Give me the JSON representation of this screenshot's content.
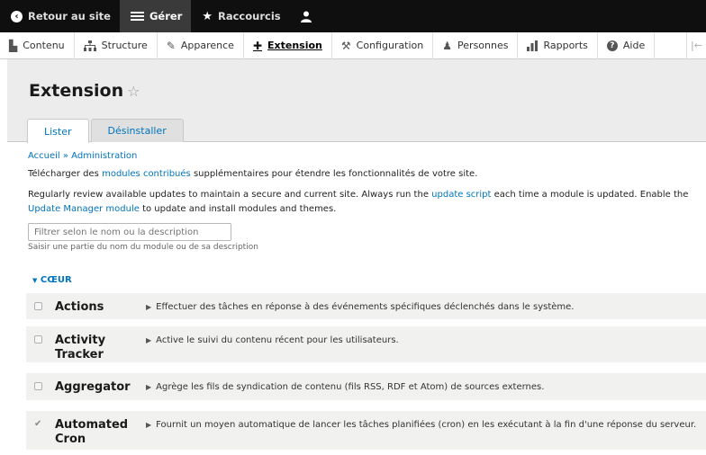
{
  "toolbar": {
    "back": "Retour au site",
    "manage": "Gérer",
    "shortcuts": "Raccourcis",
    "user_icon": "person-icon"
  },
  "tray": {
    "items": [
      {
        "label": "Contenu",
        "icon": "file-icon"
      },
      {
        "label": "Structure",
        "icon": "sitemap-icon"
      },
      {
        "label": "Apparence",
        "icon": "paint-icon"
      },
      {
        "label": "Extension",
        "icon": "puzzle-icon"
      },
      {
        "label": "Configuration",
        "icon": "wrench-icon"
      },
      {
        "label": "Personnes",
        "icon": "people-icon"
      },
      {
        "label": "Rapports",
        "icon": "bars-icon"
      },
      {
        "label": "Aide",
        "icon": "help-icon"
      }
    ],
    "active": "Extension"
  },
  "page": {
    "title": "Extension",
    "tabs": [
      "Lister",
      "Désinstaller"
    ]
  },
  "breadcrumb": "Accueil » Administration",
  "intro": {
    "prefix": "Télécharger des ",
    "link": "modules contribués",
    "suffix": " supplémentaires pour étendre les fonctionnalités de votre site."
  },
  "notice": {
    "part1": "Regularly review available updates to maintain a secure and current site. Always run the ",
    "link1": "update script",
    "part2": " each time a module is updated. Enable the ",
    "link2": "Update Manager module",
    "part3": " to update and install modules and themes."
  },
  "filter": {
    "placeholder": "Filtrer selon le nom ou la description",
    "description": "Saisir une partie du nom du module ou de sa description"
  },
  "group_label": "CŒUR",
  "modules": [
    {
      "name": "Actions",
      "description": "Effectuer des tâches en réponse à des événements spécifiques déclenchés dans le système.",
      "checked": false
    },
    {
      "name": "Activity Tracker",
      "description": "Active le suivi du contenu récent pour les utilisateurs.",
      "checked": false
    },
    {
      "name": "Aggregator",
      "description": "Agrège les fils de syndication de contenu (fils RSS, RDF et Atom) de sources externes.",
      "checked": false
    },
    {
      "name": "Automated Cron",
      "description": "Fournit un moyen automatique de lancer les tâches planifiées (cron) en les exécutant à la fin d'une réponse du serveur.",
      "checked": true
    }
  ],
  "colors": {
    "link": "#0074bd",
    "toolbar": "#0f0f0f",
    "header_bg": "#ececec"
  }
}
